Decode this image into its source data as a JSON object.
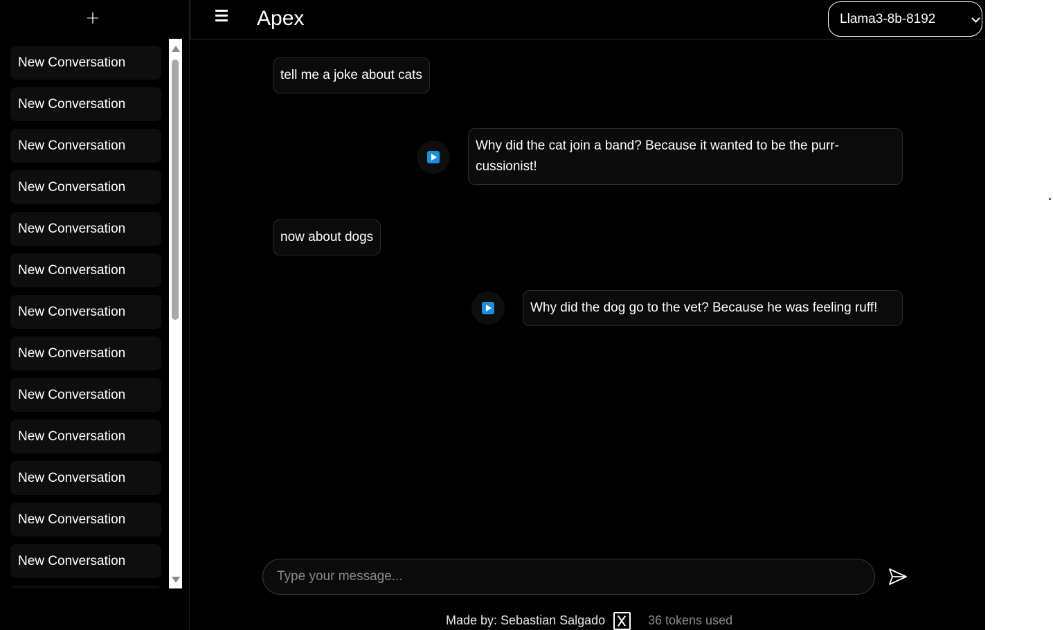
{
  "sidebar": {
    "new_chat_label": "+",
    "conversations": [
      "New Conversation",
      "New Conversation",
      "New Conversation",
      "New Conversation",
      "New Conversation",
      "New Conversation",
      "New Conversation",
      "New Conversation",
      "New Conversation",
      "New Conversation",
      "New Conversation",
      "New Conversation",
      "New Conversation"
    ]
  },
  "header": {
    "title": "Apex",
    "model": "Llama3-8b-8192",
    "menu_icon": "hamburger-menu-icon"
  },
  "messages": [
    {
      "role": "user",
      "text": "tell me a joke about cats"
    },
    {
      "role": "assistant",
      "text": "Why did the cat join a band? Because it wanted to be the purr-cussionist!"
    },
    {
      "role": "user",
      "text": "now about dogs"
    },
    {
      "role": "assistant",
      "text": "Why did the dog go to the vet? Because he was feeling ruff!"
    }
  ],
  "composer": {
    "placeholder": "Type your message...",
    "send_icon": "send-icon"
  },
  "footer": {
    "credit": "Made by: Sebastian Salgado",
    "social_icon": "x-logo-icon",
    "tokens": "36 tokens used"
  },
  "colors": {
    "background": "#000000",
    "bubble": "#0b0b0b",
    "play_accent": "#1a8fe0"
  }
}
